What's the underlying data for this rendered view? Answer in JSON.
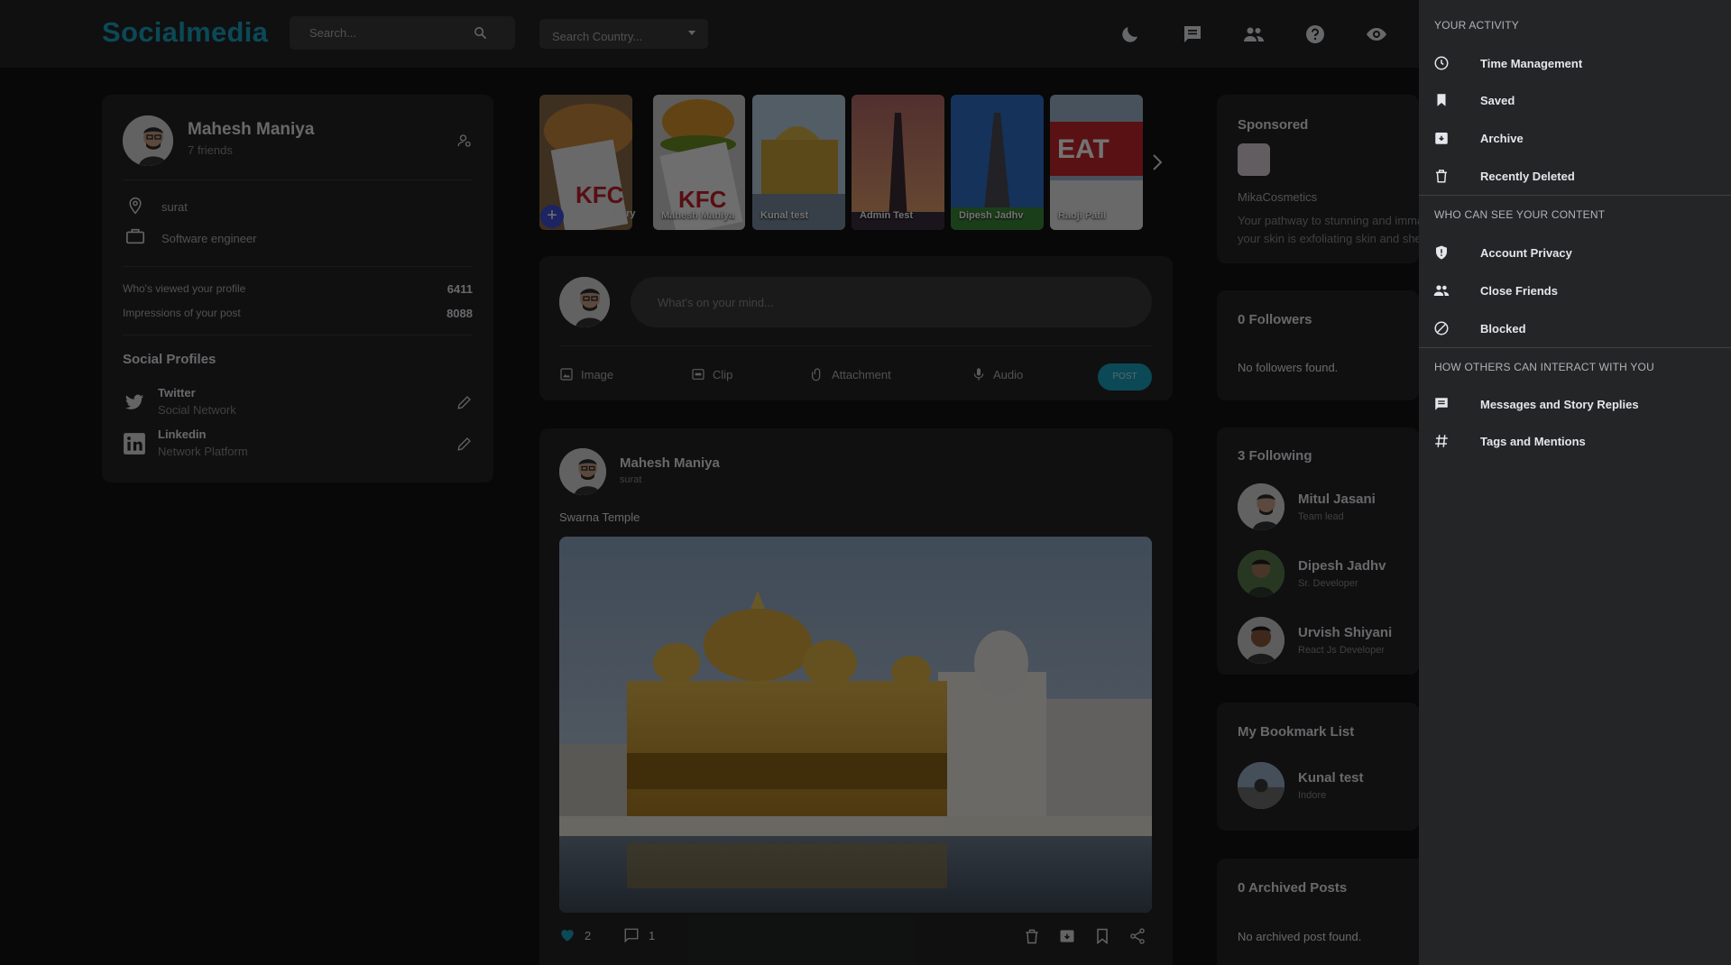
{
  "header": {
    "logo": "Socialmedia",
    "search_placeholder": "Search...",
    "country_placeholder": "Search Country...",
    "icons": [
      "moon-icon",
      "chat-icon",
      "people-icon",
      "help-icon",
      "eye-icon"
    ]
  },
  "profile": {
    "name": "Mahesh Maniya",
    "friends": "7 friends",
    "location": "surat",
    "occupation": "Software engineer",
    "stats": [
      {
        "label": "Who's viewed your profile",
        "value": "6411"
      },
      {
        "label": "Impressions of your post",
        "value": "8088"
      }
    ],
    "social_title": "Social Profiles",
    "socials": [
      {
        "name": "Twitter",
        "sub": "Social Network"
      },
      {
        "name": "Linkedin",
        "sub": "Network Platform"
      }
    ]
  },
  "stories": {
    "add_label": "Update Story",
    "items": [
      "Mahesh Maniya",
      "Kunal test",
      "Admin Test",
      "Dipesh Jadhv",
      "Raoji Patil"
    ]
  },
  "composer": {
    "placeholder": "What's on your mind...",
    "tools": [
      "Image",
      "Clip",
      "Attachment",
      "Audio"
    ],
    "post_label": "POST"
  },
  "post": {
    "author": "Mahesh Maniya",
    "location": "surat",
    "text": "Swarna Temple",
    "likes": "2",
    "comments": "1"
  },
  "right": {
    "sponsored": {
      "title": "Sponsored",
      "brand": "MikaCosmetics",
      "desc_line1": "Your pathway to stunning and immaculate",
      "desc_line2": "your skin is exfoliating skin and shedding"
    },
    "followers": {
      "title": "0 Followers",
      "empty": "No followers found."
    },
    "following": {
      "title": "3 Following",
      "items": [
        {
          "name": "Mitul Jasani",
          "role": "Team lead"
        },
        {
          "name": "Dipesh Jadhv",
          "role": "Sr. Developer"
        },
        {
          "name": "Urvish Shiyani",
          "role": "React Js Developer"
        }
      ]
    },
    "bookmarks": {
      "title": "My Bookmark List",
      "name": "Kunal test",
      "loc": "Indore"
    },
    "archived": {
      "title": "0 Archived Posts",
      "empty": "No archived post found."
    }
  },
  "drawer": {
    "sections": [
      {
        "heading": "YOUR ACTIVITY",
        "items": [
          "Time Management",
          "Saved",
          "Archive",
          "Recently Deleted"
        ]
      },
      {
        "heading": "WHO CAN SEE YOUR CONTENT",
        "items": [
          "Account Privacy",
          "Close Friends",
          "Blocked"
        ]
      },
      {
        "heading": "HOW OTHERS CAN INTERACT WITH YOU",
        "items": [
          "Messages and Story Replies",
          "Tags and Mentions"
        ]
      }
    ]
  },
  "colors": {
    "accent": "#1aa3bf",
    "background": "#121212",
    "card": "#242526",
    "drawer": "#242526"
  }
}
